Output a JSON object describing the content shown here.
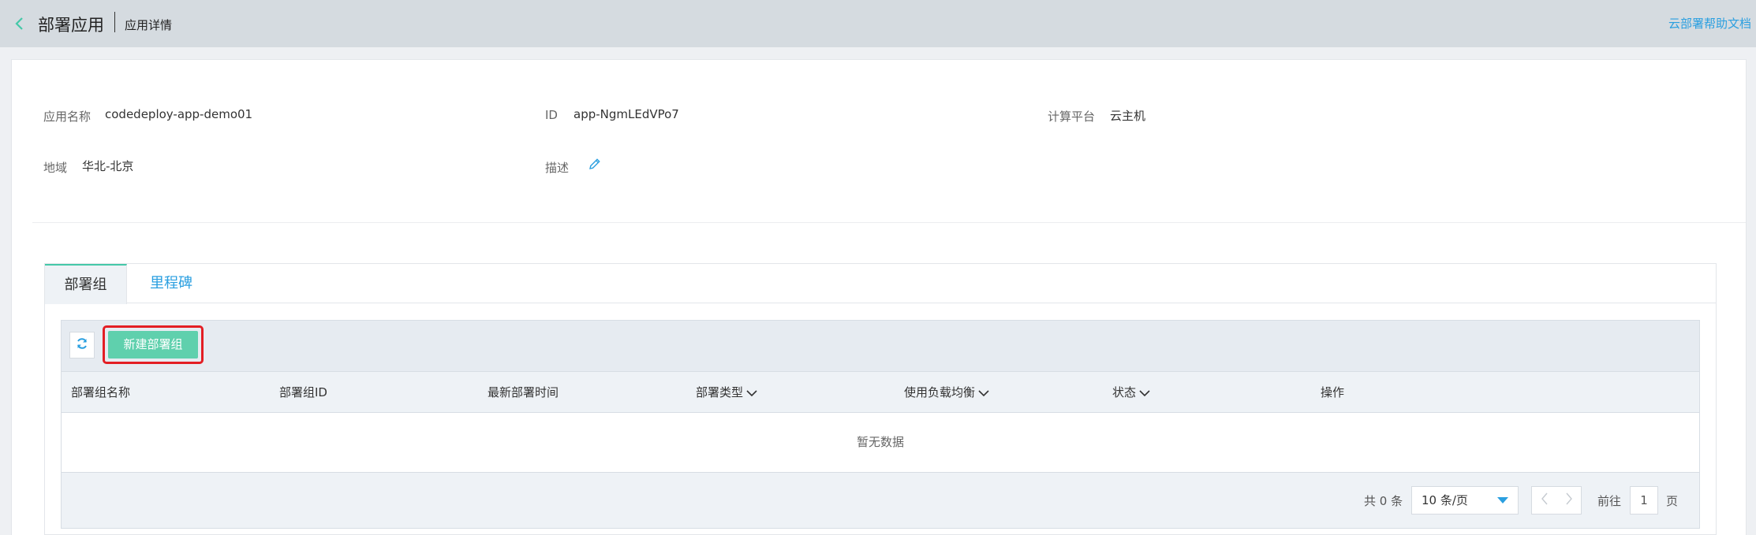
{
  "header": {
    "title": "部署应用",
    "breadcrumb": "应用详情",
    "help_link": "云部署帮助文档"
  },
  "info": {
    "app_name_label": "应用名称",
    "app_name_value": "codedeploy-app-demo01",
    "id_label": "ID",
    "id_value": "app-NgmLEdVPo7",
    "platform_label": "计算平台",
    "platform_value": "云主机",
    "region_label": "地域",
    "region_value": "华北-北京",
    "desc_label": "描述"
  },
  "tabs": [
    {
      "label": "部署组",
      "active": true
    },
    {
      "label": "里程碑",
      "active": false
    }
  ],
  "toolbar": {
    "create_label": "新建部署组"
  },
  "table": {
    "columns": [
      "部署组名称",
      "部署组ID",
      "最新部署时间",
      "部署类型",
      "使用负载均衡",
      "状态",
      "操作"
    ],
    "empty_text": "暂无数据"
  },
  "pagination": {
    "total_text": "共 0 条",
    "page_size": "10 条/页",
    "goto_label": "前往",
    "current_page": "1",
    "page_suffix": "页"
  },
  "colors": {
    "accent": "#45c8a8",
    "link": "#2a9fe0",
    "primary_button": "#5fd0ad",
    "highlight": "#e31e24"
  },
  "icons": [
    "back-arrow-icon",
    "edit-icon",
    "refresh-icon",
    "chevron-down-icon",
    "caret-down-icon",
    "chevron-left-icon",
    "chevron-right-icon"
  ]
}
